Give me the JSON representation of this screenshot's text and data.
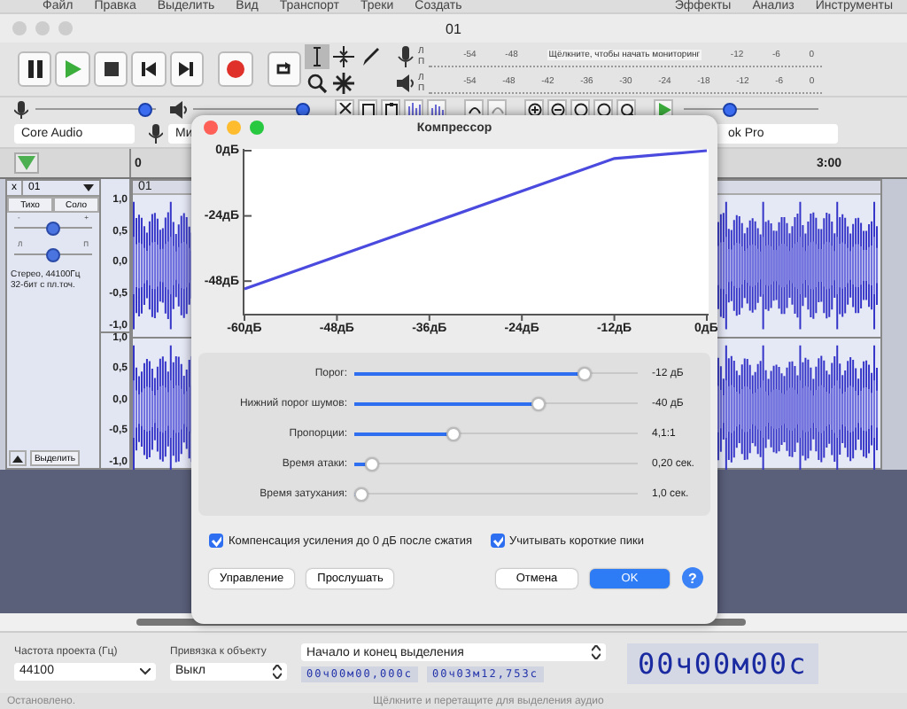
{
  "menu_bar": {
    "items_left": [
      "Файл",
      "Правка",
      "Выделить",
      "Вид",
      "Транспорт",
      "Треки",
      "Создать"
    ],
    "items_right": [
      "Эффекты",
      "Анализ",
      "Инструменты"
    ]
  },
  "window": {
    "title": "01"
  },
  "tools": [
    {
      "selected": true
    },
    {
      "selected": false
    },
    {
      "selected": false
    },
    {
      "selected": false
    },
    {
      "selected": false
    }
  ],
  "record_meter": {
    "channels": [
      "Л",
      "П"
    ],
    "ticks_before": [
      "-54",
      "-48"
    ],
    "hint": "Щёлкните, чтобы начать мониторинг",
    "ticks_after": [
      "-12",
      "-6",
      "0"
    ]
  },
  "play_meter": {
    "channels": [
      "Л",
      "П"
    ],
    "ticks": [
      "-54",
      "-48",
      "-42",
      "-36",
      "-30",
      "-24",
      "-18",
      "-12",
      "-6",
      "0"
    ]
  },
  "recording_volume": {
    "level": 0.97
  },
  "playback_volume": {
    "level": 1.0
  },
  "play_speed": {
    "level": 0.33
  },
  "devices": {
    "host": "Core Audio",
    "input": "Ми",
    "output": "ok Pro"
  },
  "timeline": {
    "start": "0",
    "end": "3:00"
  },
  "track": {
    "close": "x",
    "name": "01",
    "buttons": [
      "Тихо",
      "Соло"
    ],
    "gain_marks": [
      "-",
      "+"
    ],
    "gain": {
      "level": 0.5
    },
    "pan_marks": [
      "Л",
      "П"
    ],
    "pan": {
      "level": 0.5
    },
    "info": [
      "Стерео, 44100Гц",
      "32-бит с пл.точ."
    ],
    "select_button": "Выделить",
    "clip_name": "01",
    "scales": [
      [
        "1,0",
        "0,5",
        "0,0",
        "-0,5",
        "-1,0"
      ],
      [
        "1,0",
        "0,5",
        "0,0",
        "-0,5",
        "-1,0"
      ]
    ]
  },
  "dialog": {
    "title": "Компрессор",
    "chart_data": {
      "type": "line",
      "x": [
        -60,
        -12,
        0
      ],
      "series": [
        {
          "color": "#4a4adf",
          "values": [
            -50.9,
            -2.9,
            0
          ]
        }
      ],
      "xlim": [
        -60,
        0
      ],
      "ylim": [
        -60,
        0
      ],
      "xticks": [
        {
          "value": -60,
          "label": "-60дБ"
        },
        {
          "value": -48,
          "label": "-48дБ"
        },
        {
          "value": -36,
          "label": "-36дБ"
        },
        {
          "value": -24,
          "label": "-24дБ"
        },
        {
          "value": -12,
          "label": "-12дБ"
        },
        {
          "value": 0,
          "label": "0дБ"
        }
      ],
      "yticks": [
        {
          "value": 0,
          "label": "0дБ"
        },
        {
          "value": -24,
          "label": "-24дБ"
        },
        {
          "value": -48,
          "label": "-48дБ"
        }
      ]
    },
    "controls": [
      {
        "label": "Порог:",
        "level": 0.83,
        "reading": "-12 дБ"
      },
      {
        "label": "Нижний порог шумов:",
        "level": 0.66,
        "reading": "-40 дБ"
      },
      {
        "label": "Пропорции:",
        "level": 0.34,
        "reading": "4,1:1"
      },
      {
        "label": "Время атаки:",
        "level": 0.04,
        "reading": "0,20 сек."
      },
      {
        "label": "Время затухания:",
        "level": 0.0,
        "reading": "1,0 сек."
      }
    ],
    "checkboxes": [
      {
        "label": "Компенсация усиления до 0 дБ после сжатия",
        "checked": true
      },
      {
        "label": "Учитывать короткие пики",
        "checked": true
      }
    ],
    "left_buttons": [
      "Управление",
      "Прослушать"
    ],
    "right_buttons": [
      {
        "label": "Отмена",
        "kind": "plain"
      },
      {
        "label": "OK",
        "kind": "default"
      }
    ],
    "help": "?"
  },
  "bottom": {
    "rate_label": "Частота проекта (Гц)",
    "rate": "44100",
    "snap_label": "Привязка к объекту",
    "snap": "Выкл",
    "selection_mode": "Начало и конец выделения",
    "start_time": "00ч00м00,000с",
    "end_time": "00ч03м12,753с",
    "audio_position": "00ч00м00с"
  },
  "status_bar": {
    "state": "Остановлено.",
    "hint": "Щёлкните и перетащите для выделения аудио"
  }
}
